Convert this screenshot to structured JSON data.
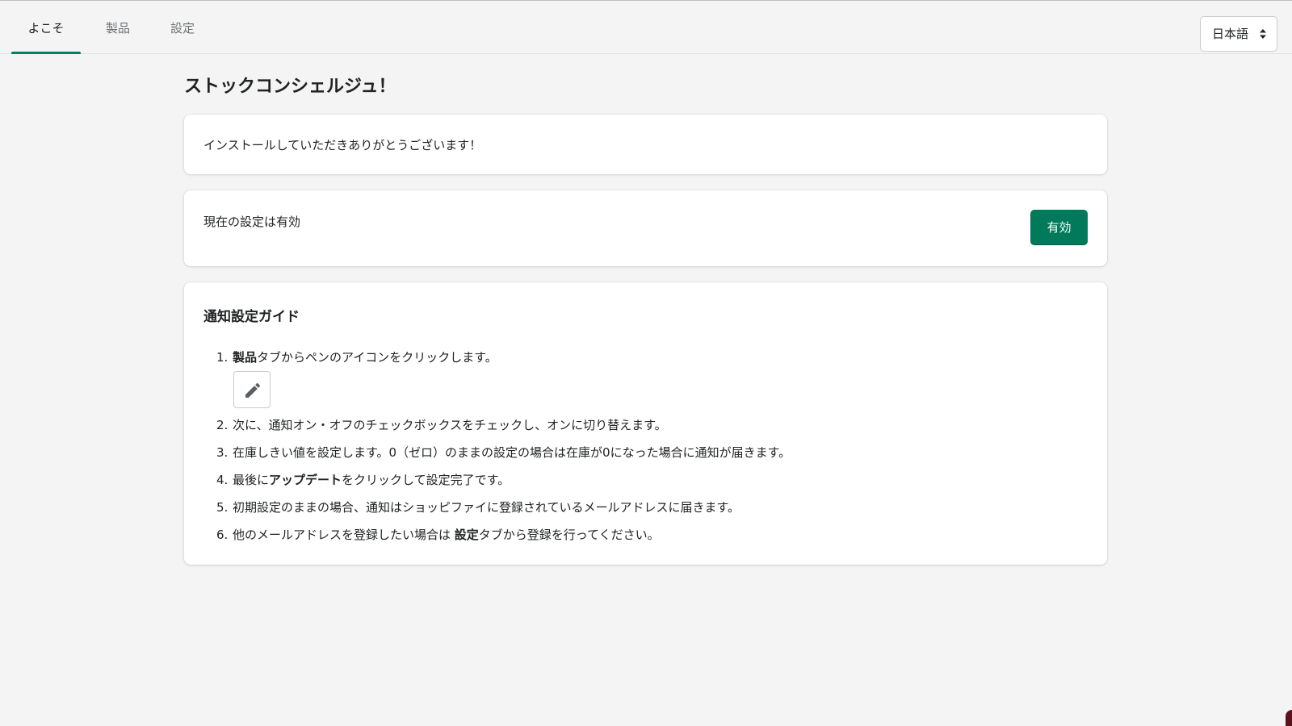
{
  "tabs": [
    {
      "label": "よこそ",
      "active": true
    },
    {
      "label": "製品",
      "active": false
    },
    {
      "label": "設定",
      "active": false
    }
  ],
  "language_select": {
    "value": "日本語",
    "icon": "select-arrows-icon"
  },
  "page_title": "ストックコンシェルジュ！",
  "thanks_card": {
    "text": "インストールしていただきありがとうございます！"
  },
  "status_card": {
    "text": "現在の設定は有効",
    "button_label": "有効"
  },
  "guide": {
    "title": "通知設定ガイド",
    "steps": [
      {
        "num": "1.",
        "bold": "製品",
        "text": "タブからペンのアイコンをクリックします。",
        "icon": "pen-icon"
      },
      {
        "num": "2.",
        "text": "次に、通知オン・オフのチェックボックスをチェックし、オンに切り替えます。"
      },
      {
        "num": "3.",
        "text": "在庫しきい値を設定します。0（ゼロ）のままの設定の場合は在庫が0になった場合に通知が届きます。"
      },
      {
        "num": "4.",
        "pre": "最後に",
        "bold": "アップデート",
        "text": "をクリックして設定完了です。"
      },
      {
        "num": "5.",
        "text": "初期設定のままの場合、通知はショッピファイに登録されているメールアドレスに届きます。"
      },
      {
        "num": "6.",
        "pre": "他のメールアドレスを登録したい場合は ",
        "bold": "設定",
        "text": "タブから登録を行ってください。"
      }
    ]
  },
  "colors": {
    "accent": "#008060",
    "button_bg": "#007a5a",
    "background": "#f4f4f4",
    "card_bg": "#ffffff"
  }
}
